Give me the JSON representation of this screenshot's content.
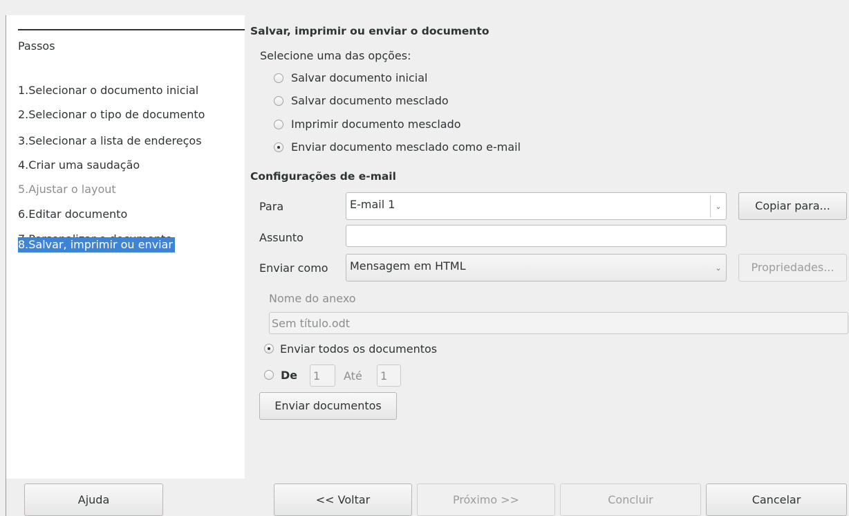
{
  "steps": {
    "title": "Passos",
    "items": [
      {
        "num": "1.",
        "label": "Selecionar o documento inicial"
      },
      {
        "num": "2.",
        "label": "Selecionar o tipo de documento"
      },
      {
        "num": "3.",
        "label": "Selecionar a lista de endereços"
      },
      {
        "num": "4.",
        "label": "Criar uma saudação"
      },
      {
        "num": "5.",
        "label": "Ajustar o layout"
      },
      {
        "num": "6.",
        "label": "Editar documento"
      },
      {
        "num": "7.",
        "label": "Personalizar o documento"
      },
      {
        "num": "8.",
        "label": "Salvar, imprimir ou enviar"
      }
    ],
    "selected_index": 7,
    "disabled_index": 4
  },
  "main": {
    "heading": "Salvar, imprimir ou enviar o documento",
    "prompt": "Selecione uma das opções:",
    "options": [
      {
        "label": "Salvar documento inicial",
        "checked": false
      },
      {
        "label": "Salvar documento mesclado",
        "checked": false
      },
      {
        "label": "Imprimir documento mesclado",
        "checked": false
      },
      {
        "label": "Enviar documento mesclado como e-mail",
        "checked": true
      }
    ]
  },
  "email": {
    "heading": "Configurações de e-mail",
    "to_label": "Para",
    "to_value": "E-mail 1",
    "copy_to_button": "Copiar para...",
    "subject_label": "Assunto",
    "subject_value": "",
    "send_as_label": "Enviar como",
    "send_as_value": "Mensagem em HTML",
    "properties_button": "Propriedades...",
    "attachment_label": "Nome do anexo",
    "attachment_value": "Sem título.odt",
    "send_all_label": "Enviar todos os documentos",
    "send_all_checked": true,
    "from_label": "De",
    "from_value": "1",
    "to_range_label": "Até",
    "to_range_value": "1",
    "send_docs_button": "Enviar documentos"
  },
  "footer": {
    "help": "Ajuda",
    "back": "<< Voltar",
    "next": "Próximo >>",
    "finish": "Concluir",
    "cancel": "Cancelar"
  },
  "colors": {
    "selection": "#3d84d6",
    "window_bg": "#efefef"
  }
}
